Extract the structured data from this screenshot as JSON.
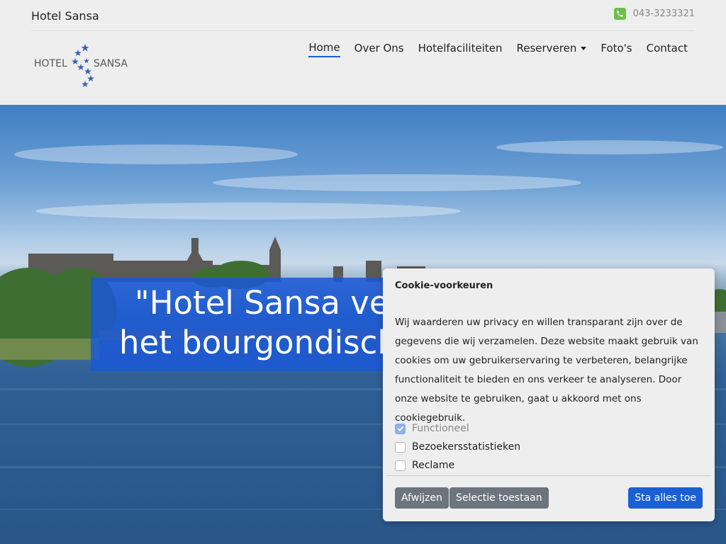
{
  "header": {
    "site_name": "Hotel Sansa",
    "phone": "043-3233321",
    "logo": {
      "left": "HOTEL",
      "right": "SANSA"
    }
  },
  "nav": {
    "items": [
      {
        "label": "Home",
        "active": true
      },
      {
        "label": "Over Ons"
      },
      {
        "label": "Hotelfaciliteiten"
      },
      {
        "label": "Reserveren",
        "dropdown": true
      },
      {
        "label": "Foto's"
      },
      {
        "label": "Contact"
      }
    ]
  },
  "hero": {
    "line1": "\"Hotel Sansa verwelkomt u in",
    "line2": "het bourgondische Maastricht\""
  },
  "cookie": {
    "title": "Cookie-voorkeuren",
    "body": "Wij waarderen uw privacy en willen transparant zijn over de gegevens die wij verzamelen. Deze website maakt gebruik van cookies om uw gebruikerservaring te verbeteren, belangrijke functionaliteit te bieden en ons verkeer te analyseren. Door onze website te gebruiken, gaat u akkoord met ons cookiegebruik.",
    "options": [
      {
        "label": "Functioneel",
        "checked": true,
        "disabled": true
      },
      {
        "label": "Bezoekersstatistieken",
        "checked": false
      },
      {
        "label": "Reclame",
        "checked": false
      }
    ],
    "buttons": {
      "reject": "Afwijzen",
      "selection": "Selectie toestaan",
      "accept_all": "Sta alles toe"
    }
  },
  "colors": {
    "accent": "#1a5fd6",
    "phone_icon": "#6cc04a",
    "button_gray": "#6c757d"
  }
}
